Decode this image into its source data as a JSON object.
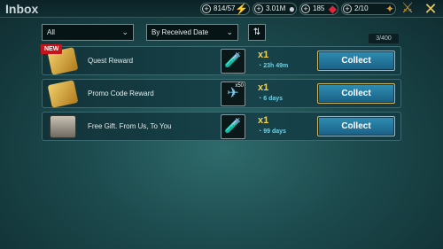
{
  "header": {
    "title": "Inbox",
    "resources": [
      {
        "value": "814/57",
        "icon": "⚡",
        "icon_name": "energy-icon",
        "color": "#b6e24a"
      },
      {
        "value": "3.01M",
        "icon": "●",
        "icon_name": "silver-icon",
        "color": "#c9d0d6"
      },
      {
        "value": "185",
        "icon": "◆",
        "icon_name": "gem-icon",
        "color": "#e2263b"
      },
      {
        "value": "2/10",
        "icon": "✦",
        "icon_name": "arena-token-icon",
        "color": "#d79a3c"
      }
    ]
  },
  "filters": {
    "category": "All",
    "sort": "By Received Date",
    "counter": "3/400"
  },
  "mails": [
    {
      "subject": "Quest Reward",
      "badge": "NEW",
      "qty": "x1",
      "time": "23h 49m",
      "reward_icon": "🧪",
      "reward_stack": "",
      "collect": "Collect"
    },
    {
      "subject": "Promo Code Reward",
      "badge": "",
      "qty": "x1",
      "time": "6 days",
      "reward_icon": "✈",
      "reward_stack": "x50",
      "collect": "Collect"
    },
    {
      "subject": "Free Gift. From Us, To You",
      "badge": "",
      "qty": "x1",
      "time": "99 days",
      "reward_icon": "🧪",
      "reward_stack": "",
      "collect": "Collect"
    }
  ]
}
